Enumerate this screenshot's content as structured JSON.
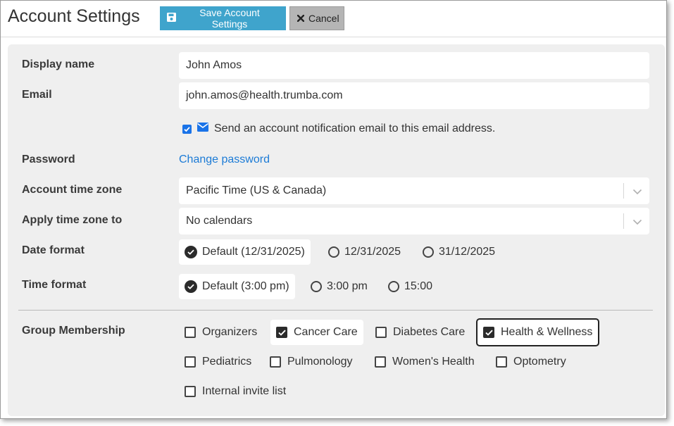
{
  "header": {
    "title": "Account Settings",
    "save_label": "Save Account Settings",
    "cancel_label": "Cancel"
  },
  "form": {
    "display_name": {
      "label": "Display name",
      "value": "John Amos"
    },
    "email": {
      "label": "Email",
      "value": "john.amos@health.trumba.com"
    },
    "notify": {
      "checked": true,
      "label": "Send an account notification email to this email address."
    },
    "password": {
      "label": "Password",
      "link": "Change password"
    },
    "timezone": {
      "label": "Account time zone",
      "value": "Pacific Time (US & Canada)"
    },
    "apply_tz": {
      "label": "Apply time zone to",
      "value": "No calendars"
    },
    "date_format": {
      "label": "Date format",
      "options": [
        "Default (12/31/2025)",
        "12/31/2025",
        "31/12/2025"
      ],
      "selected": 0
    },
    "time_format": {
      "label": "Time format",
      "options": [
        "Default (3:00 pm)",
        "3:00 pm",
        "15:00"
      ],
      "selected": 0
    },
    "groups": {
      "label": "Group Membership",
      "items": [
        {
          "label": "Organizers",
          "checked": false
        },
        {
          "label": "Cancer Care",
          "checked": true
        },
        {
          "label": "Diabetes Care",
          "checked": false
        },
        {
          "label": "Health & Wellness",
          "checked": true
        },
        {
          "label": "Pediatrics",
          "checked": false
        },
        {
          "label": "Pulmonology",
          "checked": false
        },
        {
          "label": "Women's Health",
          "checked": false
        },
        {
          "label": "Optometry",
          "checked": false
        },
        {
          "label": "Internal invite list",
          "checked": false
        }
      ]
    }
  },
  "colors": {
    "save_button": "#3fa4cc",
    "cancel_button": "#b5b5b5",
    "link": "#1c7bd6",
    "panel": "#efefef"
  },
  "icons": {
    "save": "floppy-disk-icon",
    "cancel": "x-icon",
    "mail": "envelope-icon",
    "dropdown": "chevron-down-icon"
  }
}
